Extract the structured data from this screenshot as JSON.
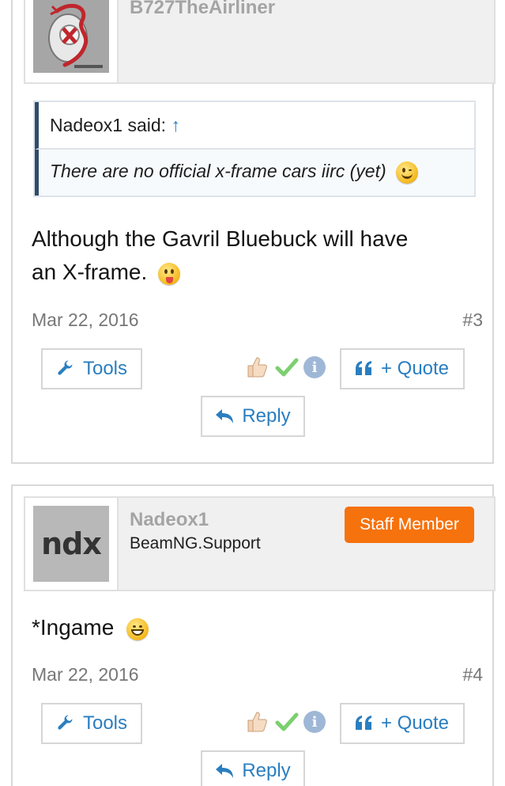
{
  "posts": [
    {
      "username": "B727TheAirliner",
      "quote": {
        "author_said": "Nadeox1 said:",
        "arrow": "↑",
        "text": "There are no official x-frame cars iirc (yet)"
      },
      "message_line1": "Although the Gavril Bluebuck will have",
      "message_line2": "an X-frame.",
      "date": "Mar 22, 2016",
      "permalink": "#3",
      "tools_label": "Tools",
      "quote_label": "+ Quote",
      "reply_label": "Reply"
    },
    {
      "username": "Nadeox1",
      "user_title": "BeamNG.Support",
      "staff_badge": "Staff Member",
      "avatar_text": "ndx",
      "message": "*Ingame",
      "date": "Mar 22, 2016",
      "permalink": "#4",
      "tools_label": "Tools",
      "quote_label": "+ Quote",
      "reply_label": "Reply"
    }
  ],
  "colors": {
    "link": "#2a7ec0",
    "badge": "#f6720d",
    "quote_bar": "#314c69"
  },
  "icons": {
    "tools": "wrench-icon",
    "quote": "quote-mark-icon",
    "reply": "reply-arrow-icon",
    "like": "thumbs-up-icon",
    "agree": "checkmark-icon",
    "info": "info-icon"
  }
}
